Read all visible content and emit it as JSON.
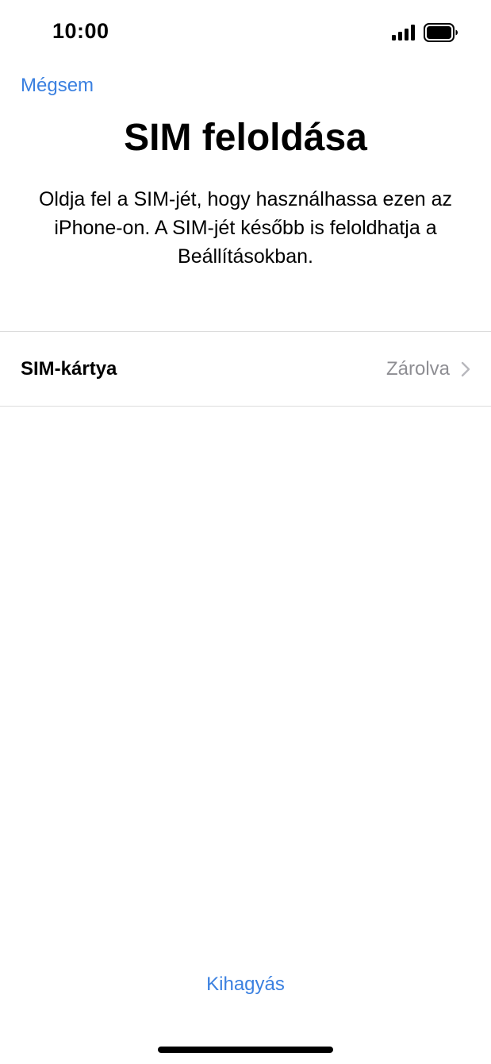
{
  "status_bar": {
    "time": "10:00",
    "signal_icon": "cellular-signal-icon",
    "battery_icon": "battery-icon"
  },
  "nav": {
    "cancel_label": "Mégsem"
  },
  "header": {
    "title": "SIM feloldása",
    "description": "Oldja fel a SIM-jét, hogy használhassa ezen az iPhone-on. A SIM-jét később is feloldhatja a Beállításokban."
  },
  "sim_row": {
    "label": "SIM-kártya",
    "value": "Zárolva",
    "chevron_icon": "chevron-right-icon"
  },
  "footer": {
    "skip_label": "Kihagyás"
  },
  "colors": {
    "accent": "#3a80e0",
    "secondary_text": "#8e8e93",
    "separator": "#dcdcdc"
  }
}
